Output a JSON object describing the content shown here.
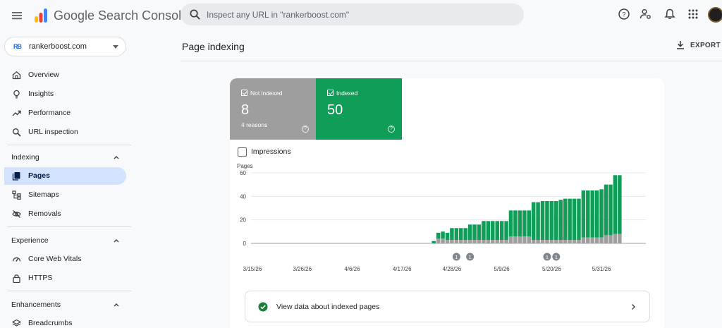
{
  "app": {
    "brand": "Google Search Console",
    "search_placeholder": "Inspect any URL in \"rankerboost.com\""
  },
  "property": {
    "name": "rankerboost.com",
    "logo_text": "RB"
  },
  "sidebar": {
    "top_items": [
      {
        "label": "Overview",
        "icon": "home-icon"
      },
      {
        "label": "Insights",
        "icon": "lightbulb-icon"
      },
      {
        "label": "Performance",
        "icon": "trending-up-icon"
      },
      {
        "label": "URL inspection",
        "icon": "search-icon"
      }
    ],
    "sections": [
      {
        "title": "Indexing",
        "items": [
          {
            "label": "Pages",
            "icon": "pages-icon",
            "active": true
          },
          {
            "label": "Sitemaps",
            "icon": "sitemap-icon"
          },
          {
            "label": "Removals",
            "icon": "eye-off-icon"
          }
        ]
      },
      {
        "title": "Experience",
        "items": [
          {
            "label": "Core Web Vitals",
            "icon": "gauge-icon"
          },
          {
            "label": "HTTPS",
            "icon": "lock-icon"
          }
        ]
      },
      {
        "title": "Enhancements",
        "items": [
          {
            "label": "Breadcrumbs",
            "icon": "layers-icon"
          }
        ]
      }
    ]
  },
  "main": {
    "title": "Page indexing",
    "export_label": "EXPORT"
  },
  "tiles": {
    "not_indexed": {
      "label": "Not indexed",
      "value": "8",
      "sub": "4 reasons",
      "help": "?"
    },
    "indexed": {
      "label": "Indexed",
      "value": "50",
      "help": "?"
    }
  },
  "impressions_label": "Impressions",
  "view_data_label": "View data about indexed pages",
  "colors": {
    "indexed": "#0f9d58",
    "not_indexed": "#9e9e9e",
    "active_nav": "#d3e3fd",
    "accent": "#1a73e8"
  },
  "chart_data": {
    "type": "bar",
    "stacked": true,
    "ylabel": "Pages",
    "ylim": [
      0,
      60
    ],
    "yticks": [
      0,
      20,
      40,
      60
    ],
    "grid": true,
    "x_start": "3/15/26",
    "xtick_labels": [
      "3/15/26",
      "3/26/26",
      "4/6/26",
      "4/17/26",
      "4/28/26",
      "5/9/26",
      "5/20/26",
      "5/31/26"
    ],
    "xtick_days": [
      0,
      11,
      22,
      33,
      44,
      55,
      66,
      77
    ],
    "x": [
      40,
      41,
      42,
      43,
      44,
      45,
      46,
      47,
      48,
      49,
      50,
      51,
      52,
      53,
      54,
      55,
      56,
      57,
      58,
      59,
      60,
      61,
      62,
      63,
      64,
      65,
      66,
      67,
      68,
      69,
      70,
      71,
      72,
      73,
      74,
      75,
      76,
      77,
      78,
      79,
      80,
      81
    ],
    "series": [
      {
        "name": "Not indexed",
        "values": [
          0,
          4,
          4,
          3,
          3,
          3,
          3,
          3,
          3,
          3,
          3,
          3,
          3,
          3,
          3,
          3,
          3,
          6,
          6,
          6,
          6,
          6,
          3,
          3,
          3,
          3,
          3,
          3,
          3,
          3,
          3,
          3,
          3,
          5,
          5,
          5,
          5,
          5,
          7,
          7,
          8,
          8
        ]
      },
      {
        "name": "Indexed",
        "values": [
          2,
          5,
          6,
          6,
          10,
          10,
          10,
          10,
          13,
          13,
          13,
          16,
          16,
          16,
          16,
          16,
          16,
          22,
          22,
          22,
          22,
          22,
          32,
          32,
          33,
          33,
          33,
          33,
          34,
          35,
          35,
          35,
          35,
          40,
          40,
          40,
          40,
          41,
          43,
          43,
          50,
          50
        ]
      }
    ],
    "annotations": [
      {
        "x": 45,
        "label": "1"
      },
      {
        "x": 48,
        "label": "1"
      },
      {
        "x": 65,
        "label": "1"
      },
      {
        "x": 67,
        "label": "1"
      }
    ]
  }
}
